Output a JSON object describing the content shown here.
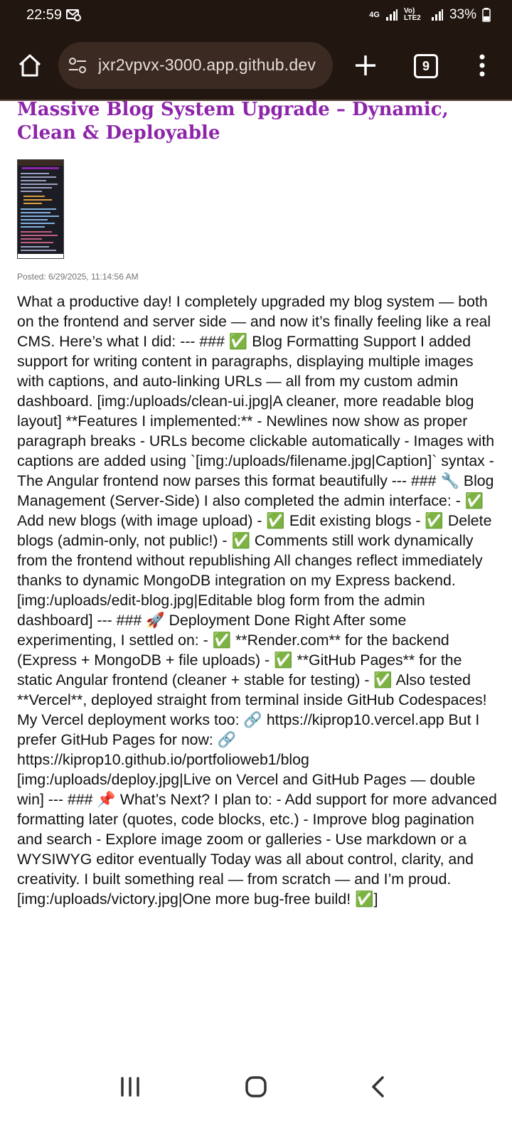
{
  "status_bar": {
    "time": "22:59",
    "network_1": "4G",
    "network_2": "Vo) LTE2",
    "battery": "33%"
  },
  "browser": {
    "url": "jxr2vpvx-3000.app.github.dev",
    "tab_count": "9"
  },
  "post": {
    "title": "Massive Blog System Upgrade – Dynamic, Clean & Deployable",
    "posted": "Posted: 6/29/2025, 11:14:56 AM",
    "body": "What a productive day! I completely upgraded my blog system — both on the frontend and server side — and now it’s finally feeling like a real CMS. Here’s what I did: --- ### ✅ Blog Formatting Support I added support for writing content in paragraphs, displaying multiple images with captions, and auto-linking URLs — all from my custom admin dashboard. [img:/uploads/clean-ui.jpg|A cleaner, more readable blog layout] **Features I implemented:** - Newlines now show as proper paragraph breaks - URLs become clickable automatically - Images with captions are added using `[img:/uploads/filename.jpg|Caption]` syntax - The Angular frontend now parses this format beautifully --- ### 🔧 Blog Management (Server-Side) I also completed the admin interface: - ✅ Add new blogs (with image upload) - ✅ Edit existing blogs - ✅ Delete blogs (admin-only, not public!) - ✅ Comments still work dynamically from the frontend without republishing All changes reflect immediately thanks to dynamic MongoDB integration on my Express backend. [img:/uploads/edit-blog.jpg|Editable blog form from the admin dashboard] --- ### 🚀 Deployment Done Right After some experimenting, I settled on: - ✅ **Render.com** for the backend (Express + MongoDB + file uploads) - ✅ **GitHub Pages** for the static Angular frontend (cleaner + stable for testing) - ✅ Also tested **Vercel**, deployed straight from terminal inside GitHub Codespaces! My Vercel deployment works too: 🔗 https://kiprop10.vercel.app But I prefer GitHub Pages for now: 🔗 https://kiprop10.github.io/portfolioweb1/blog [img:/uploads/deploy.jpg|Live on Vercel and GitHub Pages — double win] --- ### 📌 What’s Next? I plan to: - Add support for more advanced formatting later (quotes, code blocks, etc.) - Improve blog pagination and search - Explore image zoom or galleries - Use markdown or a WYSIWYG editor eventually Today was all about control, clarity, and creativity. I built something real — from scratch — and I’m proud. [img:/uploads/victory.jpg|One more bug-free build! ✅]"
  },
  "icons": {
    "home": "home-icon",
    "site_settings": "tune-icon",
    "new_tab": "plus-icon",
    "tabs": "tab-switcher-icon",
    "menu": "more-vert-icon",
    "recents": "recents-icon",
    "nav_home": "nav-home-icon",
    "back": "back-icon"
  },
  "colors": {
    "toolbar_bg": "#221610",
    "title": "#8e24aa"
  }
}
